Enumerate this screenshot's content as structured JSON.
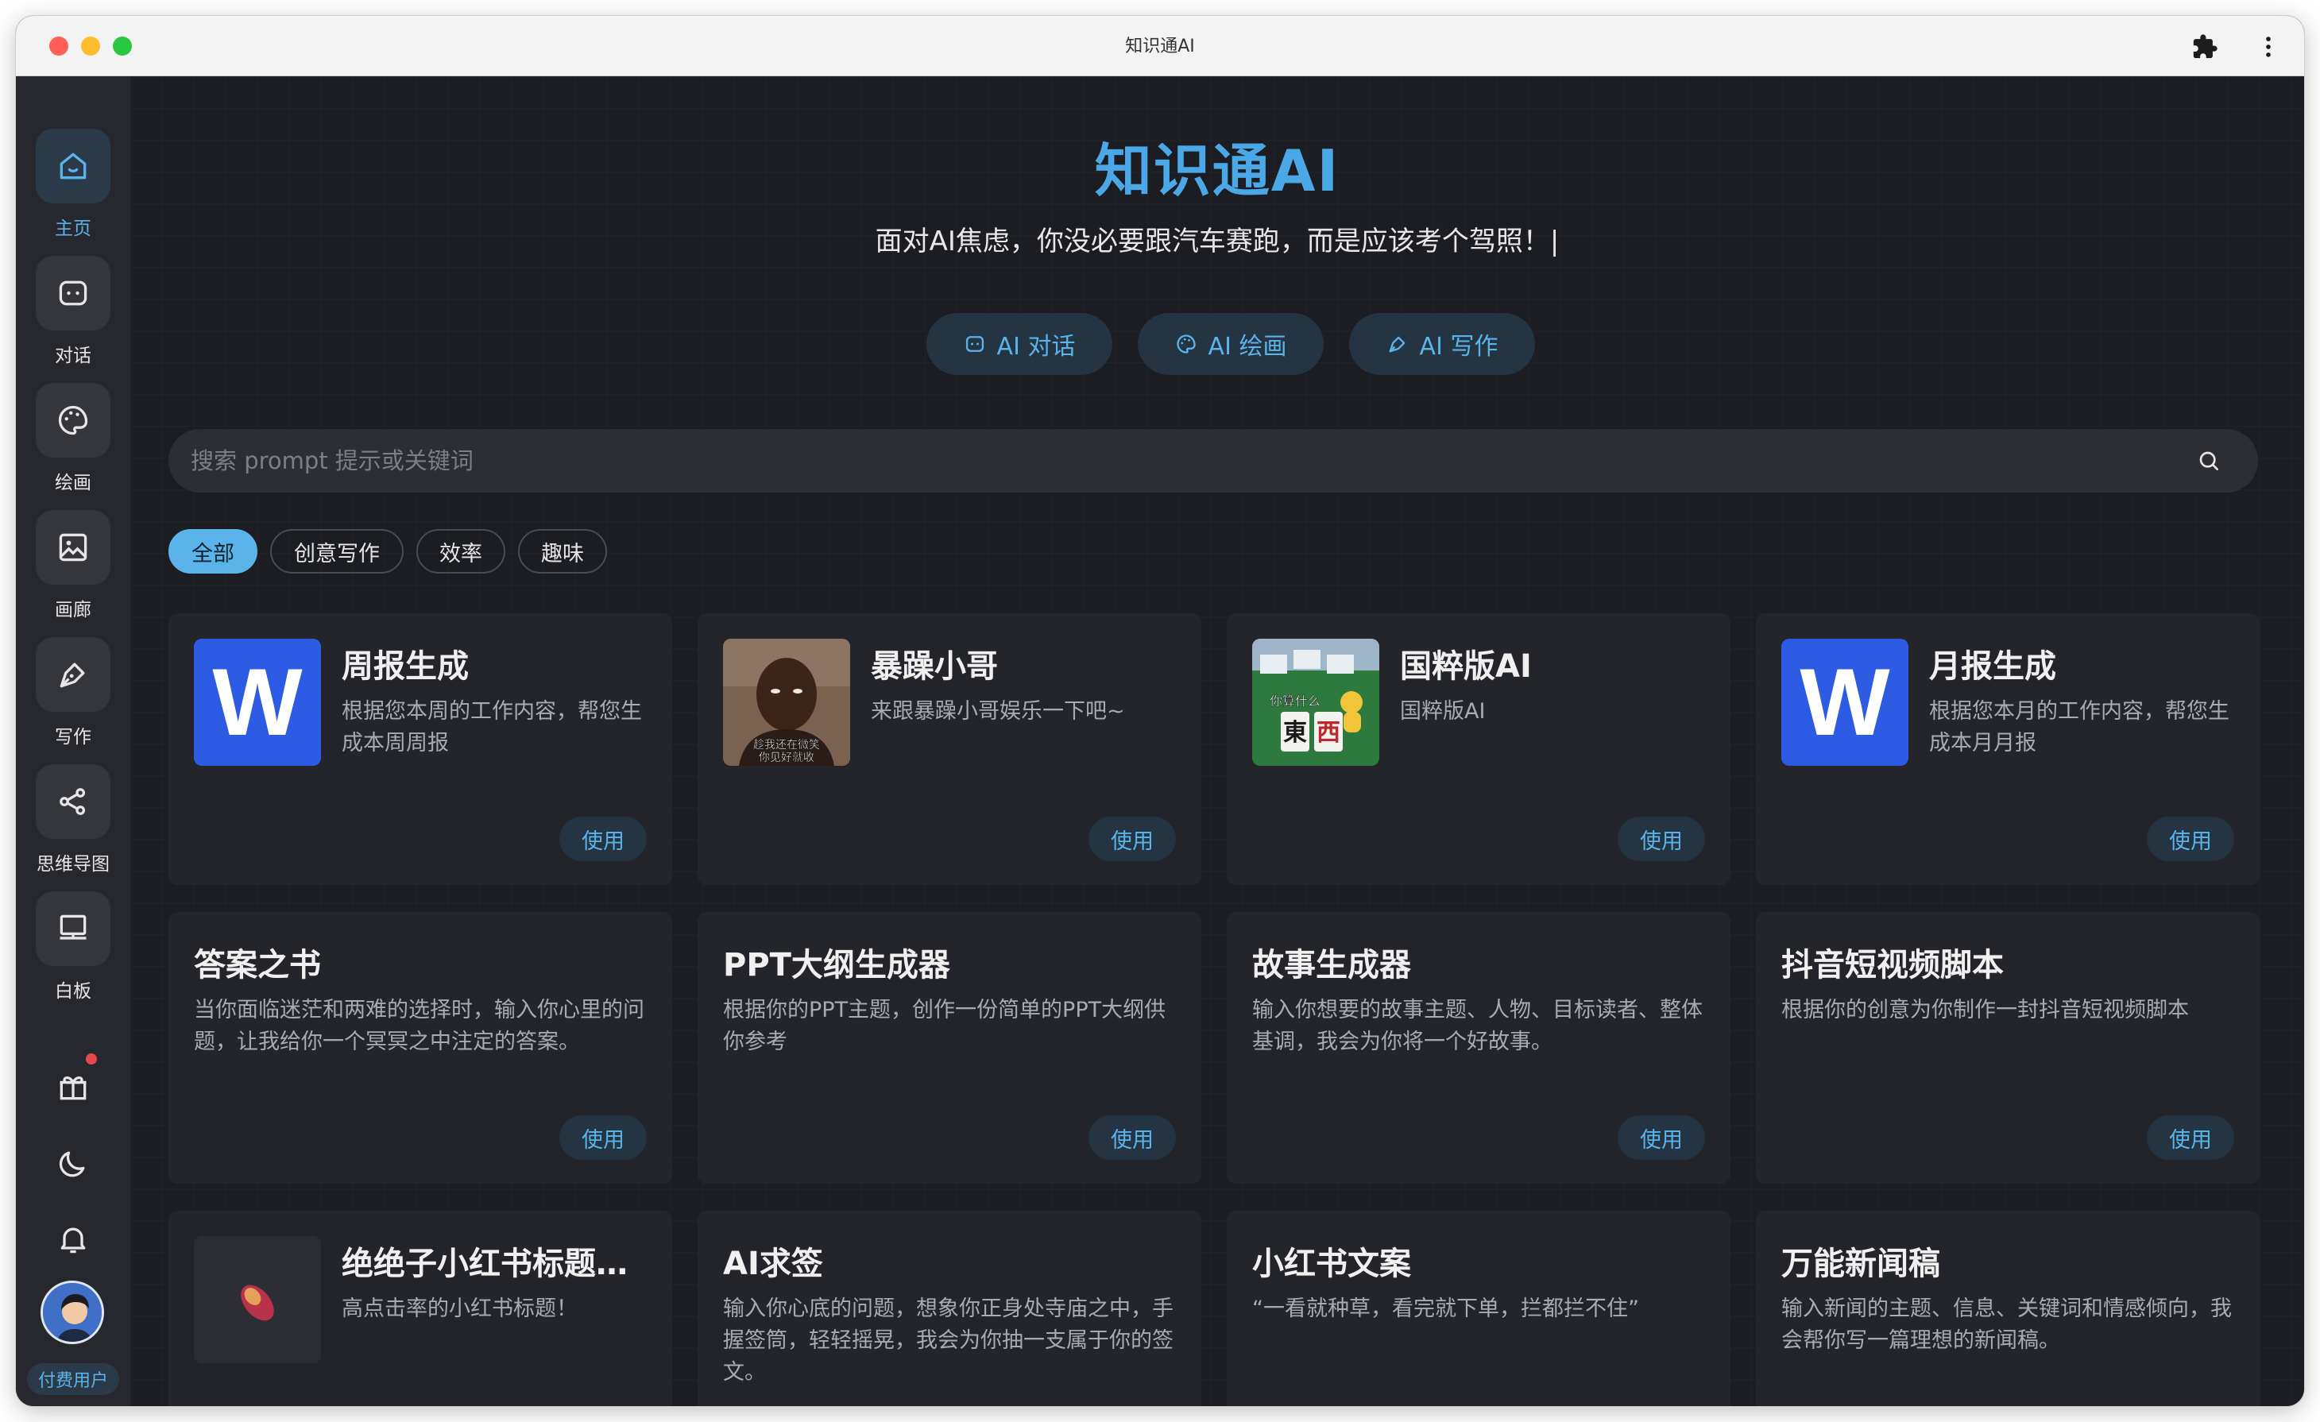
{
  "window": {
    "title": "知识通AI"
  },
  "sidebar": {
    "items": [
      {
        "label": "主页",
        "icon": "home-icon"
      },
      {
        "label": "对话",
        "icon": "chat-icon"
      },
      {
        "label": "绘画",
        "icon": "palette-icon"
      },
      {
        "label": "画廊",
        "icon": "gallery-icon"
      },
      {
        "label": "写作",
        "icon": "pen-icon"
      },
      {
        "label": "思维导图",
        "icon": "mindmap-icon"
      },
      {
        "label": "白板",
        "icon": "whiteboard-icon"
      }
    ],
    "bottom_icons": [
      "gift-icon",
      "moon-icon",
      "bell-icon"
    ],
    "user_badge": "付费用户"
  },
  "header": {
    "title": "知识通AI",
    "tagline": "面对AI焦虑，你没必要跟汽车赛跑，而是应该考个驾照！|"
  },
  "modes": [
    {
      "label": "AI 对话",
      "icon": "chat-icon"
    },
    {
      "label": "AI 绘画",
      "icon": "palette-icon"
    },
    {
      "label": "AI 写作",
      "icon": "pen-icon"
    }
  ],
  "search": {
    "placeholder": "搜索 prompt 提示或关键词"
  },
  "filters": [
    "全部",
    "创意写作",
    "效率",
    "趣味"
  ],
  "use_label": "使用",
  "cards": [
    {
      "title": "周报生成",
      "desc": "根据您本周的工作内容，帮您生成本周周报",
      "thumb": "word-icon"
    },
    {
      "title": "暴躁小哥",
      "desc": "来跟暴躁小哥娱乐一下吧~",
      "thumb": "portrait-image",
      "thumb_caption": "趁我还在微笑 你见好就收"
    },
    {
      "title": "国粹版AI",
      "desc": "国粹版AI",
      "thumb": "mahjong-image",
      "thumb_caption": "你算什么",
      "thumb_tiles": "東西"
    },
    {
      "title": "月报生成",
      "desc": "根据您本月的工作内容，帮您生成本月月报",
      "thumb": "word-icon"
    },
    {
      "title": "答案之书",
      "desc": "当你面临迷茫和两难的选择时，输入你心里的问题，让我给你一个冥冥之中注定的答案。"
    },
    {
      "title": "PPT大纲生成器",
      "desc": "根据你的PPT主题，创作一份简单的PPT大纲供你参考"
    },
    {
      "title": "故事生成器",
      "desc": "输入你想要的故事主题、人物、目标读者、整体基调，我会为你将一个好故事。"
    },
    {
      "title": "抖音短视频脚本",
      "desc": "根据你的创意为你制作一封抖音短视频脚本"
    },
    {
      "title": "绝绝子小红书标题生成器",
      "desc": "高点击率的小红书标题！",
      "thumb": "sweet-potato-image"
    },
    {
      "title": "AI求签",
      "desc": "输入你心底的问题，想象你正身处寺庙之中，手握签筒，轻轻摇晃，我会为你抽一支属于你的签文。"
    },
    {
      "title": "小红书文案",
      "desc": "“一看就种草，看完就下单，拦都拦不住”"
    },
    {
      "title": "万能新闻稿",
      "desc": "输入新闻的主题、信息、关键词和情感倾向，我会帮你写一篇理想的新闻稿。"
    }
  ],
  "colors": {
    "accent": "#4aa8e6",
    "background": "#1b1d22",
    "card": "#23252a",
    "sidebar": "#26282d"
  }
}
